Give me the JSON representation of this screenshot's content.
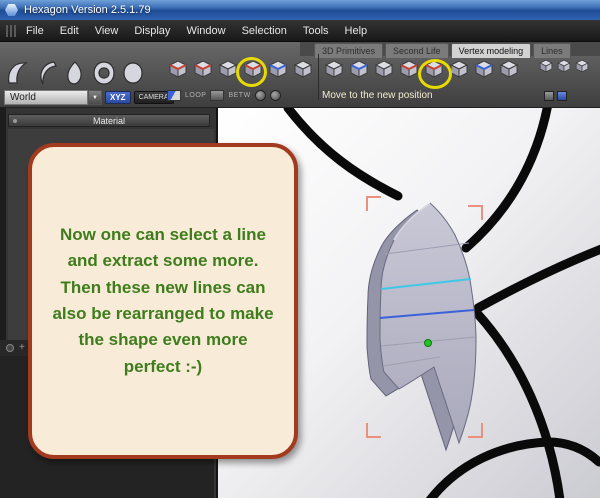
{
  "window": {
    "title": "Hexagon Version 2.5.1.79"
  },
  "menu": {
    "items": [
      "File",
      "Edit",
      "View",
      "Display",
      "Window",
      "Selection",
      "Tools",
      "Help"
    ]
  },
  "tabs": {
    "items": [
      {
        "label": "3D Primitives",
        "active": false
      },
      {
        "label": "Second Life",
        "active": false
      },
      {
        "label": "Vertex modeling",
        "active": true
      },
      {
        "label": "Lines",
        "active": false
      }
    ]
  },
  "toolbar": {
    "status_text": "Move to the new position",
    "loop_label": "LOOP",
    "betw_label": "BETW",
    "left_icons": [
      {
        "name": "box-primitive-icon",
        "accent": "#c44030"
      },
      {
        "name": "edge-select-icon",
        "accent": "#c44030"
      },
      {
        "name": "extract-edge-icon",
        "accent": null
      },
      {
        "name": "extract-line-icon",
        "accent": "#c44030"
      },
      {
        "name": "edge-loop-icon",
        "accent": "#3a62d8"
      },
      {
        "name": "remove-edge-icon",
        "accent": null
      }
    ],
    "right_icons": [
      {
        "name": "move-vertex-icon",
        "accent": null
      },
      {
        "name": "weld-vertex-icon",
        "accent": "#3a62d8"
      },
      {
        "name": "chamfer-icon",
        "accent": null
      },
      {
        "name": "extrude-face-icon",
        "accent": "#c44030"
      },
      {
        "name": "move-position-icon",
        "accent": "#c44030"
      },
      {
        "name": "scale-tool-icon",
        "accent": null
      },
      {
        "name": "sweep-tool-icon",
        "accent": "#3a62d8"
      },
      {
        "name": "smooth-tool-icon",
        "accent": null
      }
    ],
    "far_icons": [
      {
        "name": "symmetry-icon"
      },
      {
        "name": "mirror-icon"
      },
      {
        "name": "bend-icon"
      }
    ]
  },
  "panels": {
    "world_value": "World",
    "xyz_label": "XYZ",
    "camera_label": "CAMERA",
    "material_title": "Material"
  },
  "callout": {
    "text": "Now one can select a line and extract some more. Then these new lines can also be rearranged to make the shape even more perfect :-)"
  },
  "colors": {
    "highlight_yellow": "#e6da00",
    "bubble_bg": "#f8ecd8",
    "bubble_border": "#a23b1e",
    "bubble_text": "#3e7c1c",
    "selection_bracket": "#e8917d",
    "edge_cyan": "#3fc8e6",
    "edge_selected_blue": "#3a62d8",
    "pivot_green": "#21c421"
  }
}
